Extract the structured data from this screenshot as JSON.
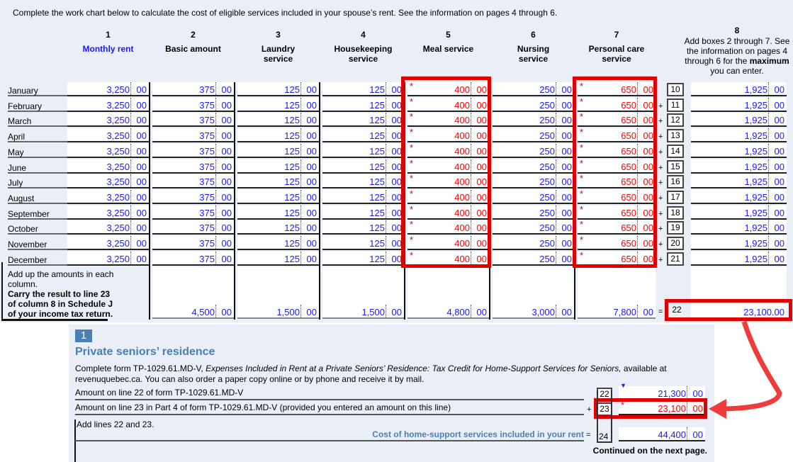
{
  "intro": "Complete the work chart below to calculate the cost of eligible services included in your spouse’s rent. See the information on pages 4 through 6.",
  "columns": [
    {
      "num": "1",
      "label": "Monthly rent",
      "blue": true
    },
    {
      "num": "2",
      "label": "Basic amount"
    },
    {
      "num": "3",
      "label": "Laundry service"
    },
    {
      "num": "4",
      "label": "Housekeeping service"
    },
    {
      "num": "5",
      "label": "Meal service"
    },
    {
      "num": "6",
      "label": "Nursing service"
    },
    {
      "num": "7",
      "label": "Personal care service"
    }
  ],
  "col8": {
    "num": "8",
    "text_pre": "Add boxes 2 through 7. See the information on pages 4 through 6 for the ",
    "text_bold": "maximum",
    "text_post": " you can enter."
  },
  "months": [
    "January",
    "February",
    "March",
    "April",
    "May",
    "June",
    "July",
    "August",
    "September",
    "October",
    "November",
    "December"
  ],
  "row_values": [
    "3,250",
    "375",
    "125",
    "125",
    "400",
    "250",
    "650"
  ],
  "row_cents": "00",
  "line_boxes": [
    "10",
    "11",
    "12",
    "13",
    "14",
    "15",
    "16",
    "17",
    "18",
    "19",
    "20",
    "21"
  ],
  "col8_value": "1,925",
  "totals_label": {
    "normal": "Add up the amounts in each column.",
    "bold": "Carry the result to line 23 of column 8 in Schedule J of your income tax return."
  },
  "totals": [
    "4,500",
    "1,500",
    "1,500",
    "4,800",
    "3,000",
    "7,800"
  ],
  "line22": {
    "box": "22",
    "value": "23,100.00"
  },
  "highlight_color": "#e00000",
  "panel": {
    "section": "1",
    "title": "Private seniors’ residence",
    "text_pre": "Complete form TP-1029.61.MD-V, ",
    "text_italic": "Expenses Included in Rent at a Private Seniors’ Residence: Tax Credit for Home-Support Services for Seniors,",
    "text_post": " available at revenuquebec.ca. You can also order a paper copy online or by phone and receive it by mail.",
    "lines": [
      {
        "label": "Amount on line 22 of form TP-1029.61.MD-V",
        "op": "",
        "box": "22",
        "value": "21,300",
        "cents": "00"
      },
      {
        "label": "Amount on line 23 in Part 4 of form TP-1029.61.MD-V (provided you entered an amount on this line)",
        "op": "+",
        "box": "23",
        "value": "23,100",
        "cents": "00"
      }
    ],
    "add_label": "Add lines 22 and 23.",
    "total_label": "Cost of home-support services included in your rent",
    "total_op": "=",
    "total_box": "24",
    "total_value": "44,400",
    "total_cents": "00",
    "continued": "Continued on the next page."
  }
}
